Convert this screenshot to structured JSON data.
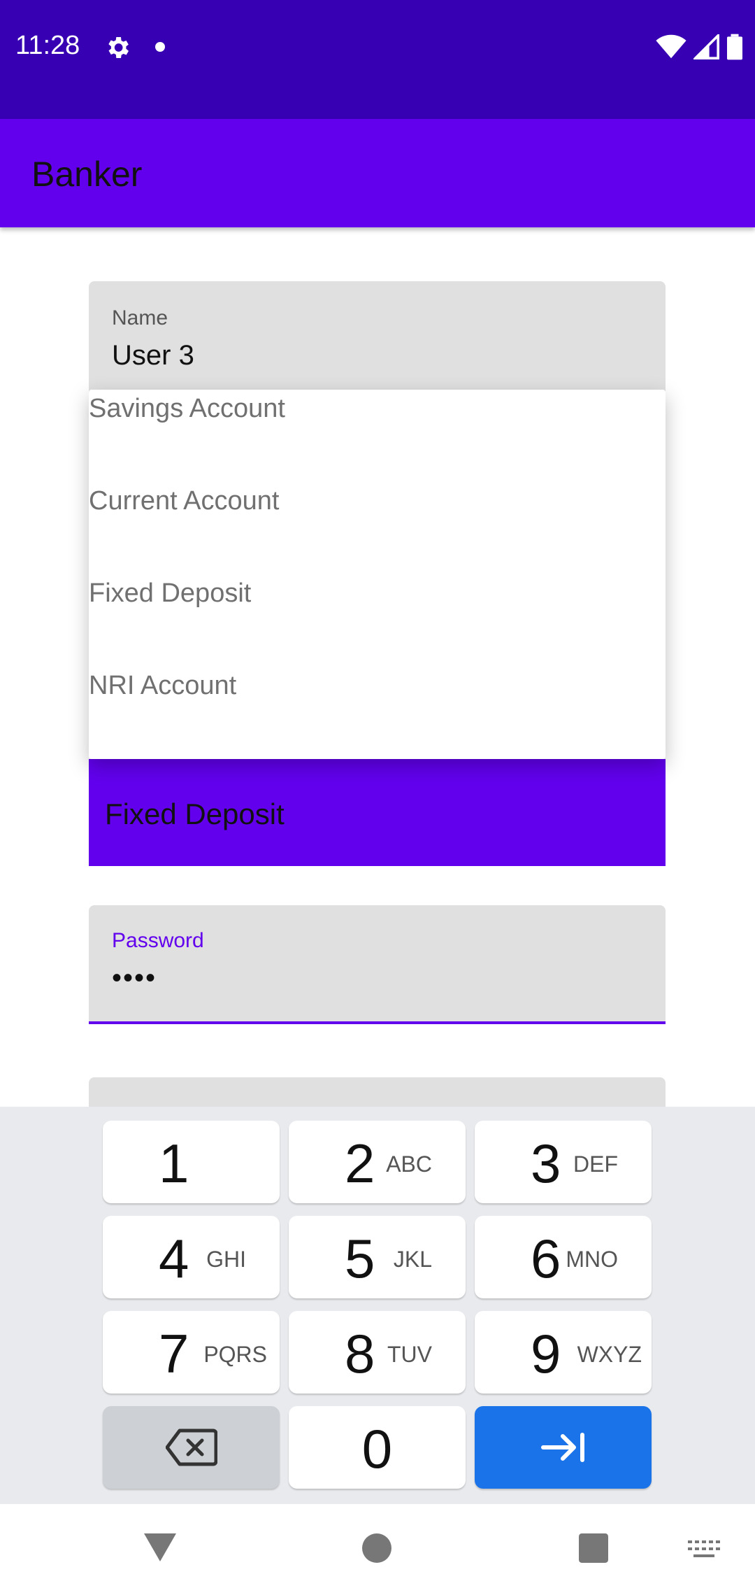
{
  "status_bar": {
    "time": "11:28",
    "icons": [
      "gear-icon",
      "notification-dot-icon",
      "wifi-icon",
      "signal-icon",
      "battery-icon"
    ]
  },
  "app_bar": {
    "title": "Banker"
  },
  "name_field": {
    "label": "Name",
    "value": "User 3"
  },
  "account_dropdown": {
    "options": [
      "Savings Account",
      "Current Account",
      "Fixed Deposit",
      "NRI Account"
    ],
    "selected": "Fixed Deposit"
  },
  "password_field": {
    "label": "Password",
    "value": "••••"
  },
  "keyboard": {
    "keys": [
      {
        "num": "1",
        "letters": ""
      },
      {
        "num": "2",
        "letters": "ABC"
      },
      {
        "num": "3",
        "letters": "DEF"
      },
      {
        "num": "4",
        "letters": "GHI"
      },
      {
        "num": "5",
        "letters": "JKL"
      },
      {
        "num": "6",
        "letters": "MNO"
      },
      {
        "num": "7",
        "letters": "PQRS"
      },
      {
        "num": "8",
        "letters": "TUV"
      },
      {
        "num": "9",
        "letters": "WXYZ"
      },
      {
        "num": "0",
        "letters": ""
      }
    ],
    "action_icons": [
      "backspace-icon",
      "next-field-icon"
    ]
  },
  "nav_bar": {
    "icons": [
      "back-icon",
      "home-icon",
      "recents-icon",
      "keyboard-switch-icon"
    ]
  },
  "colors": {
    "status_bar": "#3700b3",
    "primary": "#6200ee",
    "keyboard_bg": "#e8eaed",
    "action_key": "#1a73e8"
  }
}
